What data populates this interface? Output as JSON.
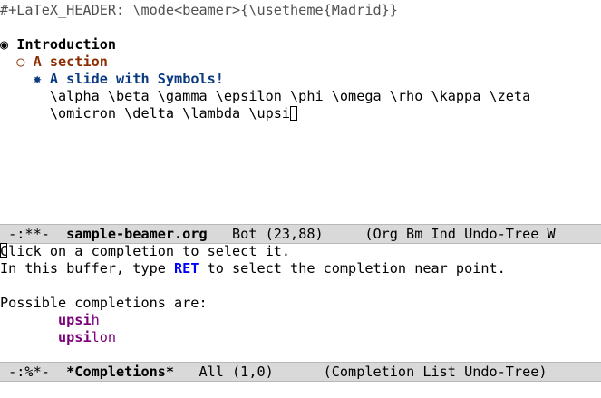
{
  "editor": {
    "header_line": "#+LaTeX_HEADER: \\mode<beamer>{\\usetheme{Madrid}}",
    "outline": [
      {
        "bullet": "◉",
        "text": "Introduction"
      },
      {
        "bullet": "○",
        "text": "A section"
      },
      {
        "bullet": "✸",
        "text": "A slide with Symbols!"
      }
    ],
    "body_line1": "\\alpha \\beta \\gamma \\epsilon \\phi \\omega \\rho \\kappa \\zeta",
    "body_line2": "\\omicron \\delta \\lambda \\upsi"
  },
  "modeline_main": {
    "status": " -:**-  ",
    "buffer": "sample-beamer.org",
    "position": "   Bot (23,88)",
    "modes": "     (Org Bm Ind Undo-Tree W"
  },
  "completions": {
    "line1_first": "C",
    "line1_rest": "lick on a completion to select it.",
    "line2_pre": "In this buffer, type ",
    "line2_key": "RET",
    "line2_post": " to select the completion near point.",
    "line4": "Possible completions are:",
    "items": [
      {
        "common": "upsi",
        "rest": "h"
      },
      {
        "common": "upsi",
        "rest": "lon"
      }
    ]
  },
  "modeline_comp": {
    "status": " -:%*-  ",
    "buffer": "*Completions*",
    "position": "   All (1,0)",
    "modes": "      (Completion List Undo-Tree)"
  }
}
